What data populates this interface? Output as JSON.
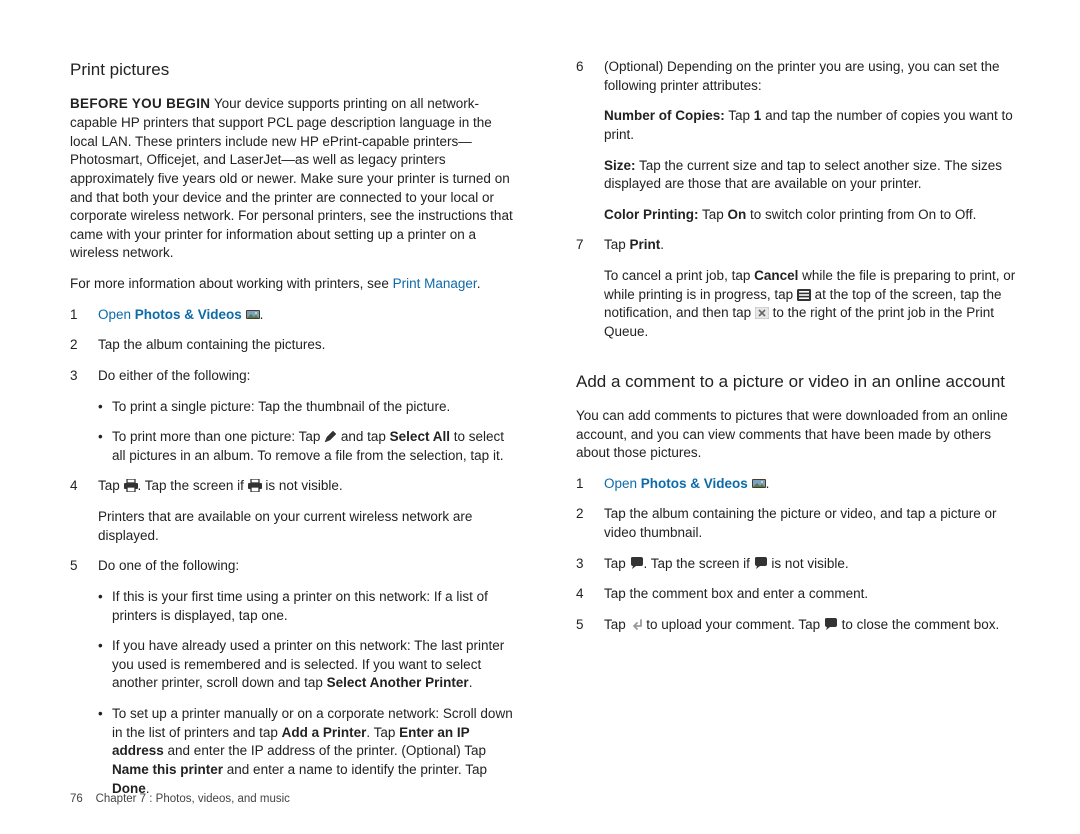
{
  "left": {
    "title": "Print pictures",
    "before_label": "BEFORE YOU BEGIN",
    "before_text": " Your device supports printing on all network-capable HP printers that support PCL page description language in the local LAN. These printers include new HP ePrint-capable printers—Photosmart, Officejet, and LaserJet—as well as legacy printers approximately five years old or newer. Make sure your printer is turned on and that both your device and the printer are connected to your local or corporate wireless network. For personal printers, see the instructions that came with your printer for information about setting up a printer on a wireless network.",
    "more_info_pre": "For more information about working with printers, see ",
    "more_info_link": "Print Manager",
    "more_info_post": ".",
    "s1_open": "Open",
    "s1_app": "Photos & Videos",
    "s1_period": ".",
    "s2": "Tap the album containing the pictures.",
    "s3": "Do either of the following:",
    "s3b1": "To print a single picture: Tap the thumbnail of the picture.",
    "s3b2a": "To print more than one picture: Tap ",
    "s3b2b": " and tap ",
    "s3b2c": "Select All",
    "s3b2d": " to select all pictures in an album. To remove a file from the selection, tap it.",
    "s4a": "Tap ",
    "s4b": ". Tap the screen if ",
    "s4c": " is not visible.",
    "s4p": "Printers that are available on your current wireless network are displayed.",
    "s5": "Do one of the following:",
    "s5b1": "If this is your first time using a printer on this network: If a list of printers is displayed, tap one.",
    "s5b2a": "If you have already used a printer on this network: The last printer you used is remembered and is selected. If you want to select another printer, scroll down and tap ",
    "s5b2b": "Select Another Printer",
    "s5b2c": ".",
    "s5b3a": "To set up a printer manually or on a corporate network: Scroll down in the list of printers and tap ",
    "s5b3b": "Add a Printer",
    "s5b3c": ". Tap ",
    "s5b3d": "Enter an IP address",
    "s5b3e": " and enter the IP address of the printer. (Optional) Tap ",
    "s5b3f": "Name this printer",
    "s5b3g": " and enter a name to identify the printer. Tap ",
    "s5b3h": "Done",
    "s5b3i": "."
  },
  "right": {
    "s6": "(Optional) Depending on the printer you are using, you can set the following printer attributes:",
    "nc_a": "Number of Copies:",
    "nc_b": " Tap ",
    "nc_c": "1",
    "nc_d": " and tap the number of copies you want to print.",
    "sz_a": "Size:",
    "sz_b": " Tap the current size and tap to select another size. The sizes displayed are those that are available on your printer.",
    "cp_a": "Color Printing:",
    "cp_b": " Tap ",
    "cp_c": "On",
    "cp_d": " to switch color printing from On to Off.",
    "s7a": "Tap ",
    "s7b": "Print",
    "s7c": ".",
    "s7p_a": "To cancel a print job, tap ",
    "s7p_b": "Cancel",
    "s7p_c": " while the file is preparing to print, or while printing is in progress, tap ",
    "s7p_d": " at the top of the screen, tap the notification, and then tap ",
    "s7p_e": " to the right of the print job in the Print Queue.",
    "h2": "Add a comment to a picture or video in an online account",
    "intro": "You can add comments to pictures that were downloaded from an online account, and you can view comments that have been made by others about those pictures.",
    "c1_open": "Open",
    "c1_app": "Photos & Videos",
    "c1_period": ".",
    "c2": "Tap the album containing the picture or video, and tap a picture or video thumbnail.",
    "c3a": "Tap ",
    "c3b": ". Tap the screen if ",
    "c3c": " is not visible.",
    "c4": "Tap the comment box and enter a comment.",
    "c5a": "Tap ",
    "c5b": " to upload your comment. Tap ",
    "c5c": " to close the comment box."
  },
  "footer": {
    "page": "76",
    "chapter": "Chapter 7 : Photos, videos, and music"
  }
}
